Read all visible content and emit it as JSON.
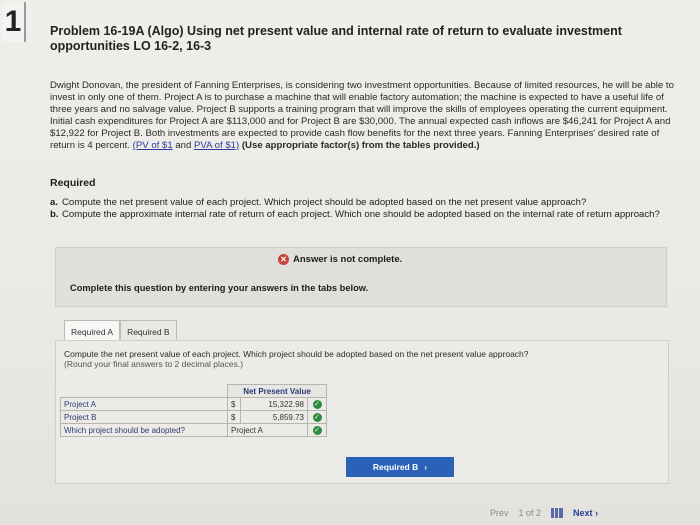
{
  "problem_number": "1",
  "title": "Problem 16-19A (Algo) Using net present value and internal rate of return to evaluate investment opportunities LO 16-2, 16-3",
  "intro": {
    "text": "Dwight Donovan, the president of Fanning Enterprises, is considering two investment opportunities. Because of limited resources, he will be able to invest in only one of them. Project A is to purchase a machine that will enable factory automation; the machine is expected to have a useful life of three years and no salvage value. Project B supports a training program that will improve the skills of employees operating the current equipment. Initial cash expenditures for Project A are $113,000 and for Project B are $30,000. The annual expected cash inflows are $46,241 for Project A and $12,922 for Project B. Both investments are expected to provide cash flow benefits for the next three years. Fanning Enterprises' desired rate of return is 4 percent.",
    "link_pv": "(PV of $1",
    "and": "and",
    "link_pva": "PVA of $1)",
    "use_factors": "(Use appropriate factor(s) from the tables provided.)"
  },
  "required_heading": "Required",
  "requirements": [
    {
      "letter": "a.",
      "text": "Compute the net present value of each project. Which project should be adopted based on the net present value approach?"
    },
    {
      "letter": "b.",
      "text": "Compute the approximate internal rate of return of each project. Which one should be adopted based on the internal rate of return approach?"
    }
  ],
  "answer_status": "Answer is not complete.",
  "complete_instruction": "Complete this question by entering your answers in the tabs below.",
  "tabs": [
    {
      "label": "Required A",
      "active": true
    },
    {
      "label": "Required B",
      "active": false
    }
  ],
  "panel": {
    "instruction": "Compute the net present value of each project. Which project should be adopted based on the net present value approach?",
    "hint": "(Round your final answers to 2 decimal places.)",
    "column_header": "Net Present Value",
    "rows": [
      {
        "label": "Project A",
        "currency": "$",
        "value": "15,322.98"
      },
      {
        "label": "Project B",
        "currency": "$",
        "value": "5,859.73"
      },
      {
        "label": "Which project should be adopted?",
        "currency": "",
        "value": "Project A"
      }
    ]
  },
  "next_button_label": "Required B",
  "pager": {
    "prev": "Prev",
    "position": "1 of 2",
    "next": "Next"
  },
  "colors": {
    "accent": "#2a62b9",
    "error": "#c9443c",
    "correct": "#2d8a3e"
  }
}
